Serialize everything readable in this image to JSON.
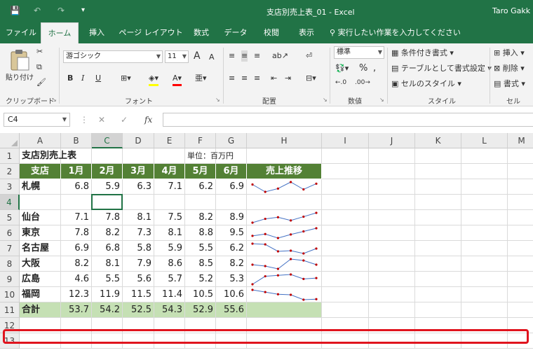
{
  "titlebar": {
    "title": "支店別売上表_01 - Excel",
    "user": "Taro Gakk",
    "save_glyph": "💾",
    "undo_glyph": "↶",
    "redo_glyph": "↷",
    "customize_glyph": "▾"
  },
  "tabs": [
    "ファイル",
    "ホーム",
    "挿入",
    "ページ レイアウト",
    "数式",
    "データ",
    "校閲",
    "表示"
  ],
  "tellme": "実行したい作業を入力してください",
  "ribbon": {
    "paste_label": "貼り付け",
    "font_name": "游ゴシック",
    "font_size": "11",
    "grow_font": "A",
    "shrink_font": "A",
    "bold": "B",
    "italic": "I",
    "underline": "U",
    "number_format": "標準",
    "percent": "%",
    "comma": ",",
    "cond_format": "条件付き書式",
    "table_format": "テーブルとして書式設定",
    "cell_style": "セルのスタイル",
    "insert": "挿入",
    "delete": "削除",
    "format": "書式",
    "groups": {
      "clipboard": "クリップボード",
      "font": "フォント",
      "alignment": "配置",
      "number": "数値",
      "styles": "スタイル",
      "cells": "セル"
    }
  },
  "formula_bar": {
    "name_box": "C4",
    "cancel": "✕",
    "enter": "✓",
    "fx": "fx",
    "value": ""
  },
  "columns": [
    "A",
    "B",
    "C",
    "D",
    "E",
    "F",
    "G",
    "H",
    "I",
    "J",
    "K",
    "L",
    "M"
  ],
  "rows": [
    "1",
    "2",
    "3",
    "4",
    "5",
    "6",
    "7",
    "8",
    "9",
    "10",
    "11",
    "12",
    "13"
  ],
  "sheet": {
    "title": "支店別売上表",
    "unit": "単位：百万円",
    "headers": [
      "支店",
      "1月",
      "2月",
      "3月",
      "4月",
      "5月",
      "6月",
      "売上推移"
    ],
    "data": [
      {
        "branch": "札幌",
        "values": [
          "6.8",
          "5.9",
          "6.3",
          "7.1",
          "6.2",
          "6.9"
        ]
      },
      {
        "branch": "仙台",
        "values": [
          "7.1",
          "7.8",
          "8.1",
          "7.5",
          "8.2",
          "8.9"
        ]
      },
      {
        "branch": "東京",
        "values": [
          "7.8",
          "8.2",
          "7.3",
          "8.1",
          "8.8",
          "9.5"
        ]
      },
      {
        "branch": "名古屋",
        "values": [
          "6.9",
          "6.8",
          "5.8",
          "5.9",
          "5.5",
          "6.2"
        ]
      },
      {
        "branch": "大阪",
        "values": [
          "8.2",
          "8.1",
          "7.9",
          "8.6",
          "8.5",
          "8.2"
        ]
      },
      {
        "branch": "広島",
        "values": [
          "4.6",
          "5.5",
          "5.6",
          "5.7",
          "5.2",
          "5.3"
        ]
      },
      {
        "branch": "福岡",
        "values": [
          "12.3",
          "11.9",
          "11.5",
          "11.4",
          "10.5",
          "10.6"
        ]
      }
    ],
    "total": {
      "label": "合計",
      "values": [
        "53.7",
        "54.2",
        "52.5",
        "54.3",
        "52.9",
        "55.6"
      ]
    }
  },
  "colors": {
    "excel_green": "#217346",
    "header_fill": "#538135",
    "total_fill": "#c5e0b4",
    "highlight": "#e0141e",
    "sparkline": "#4472c4",
    "marker": "#c00000"
  }
}
